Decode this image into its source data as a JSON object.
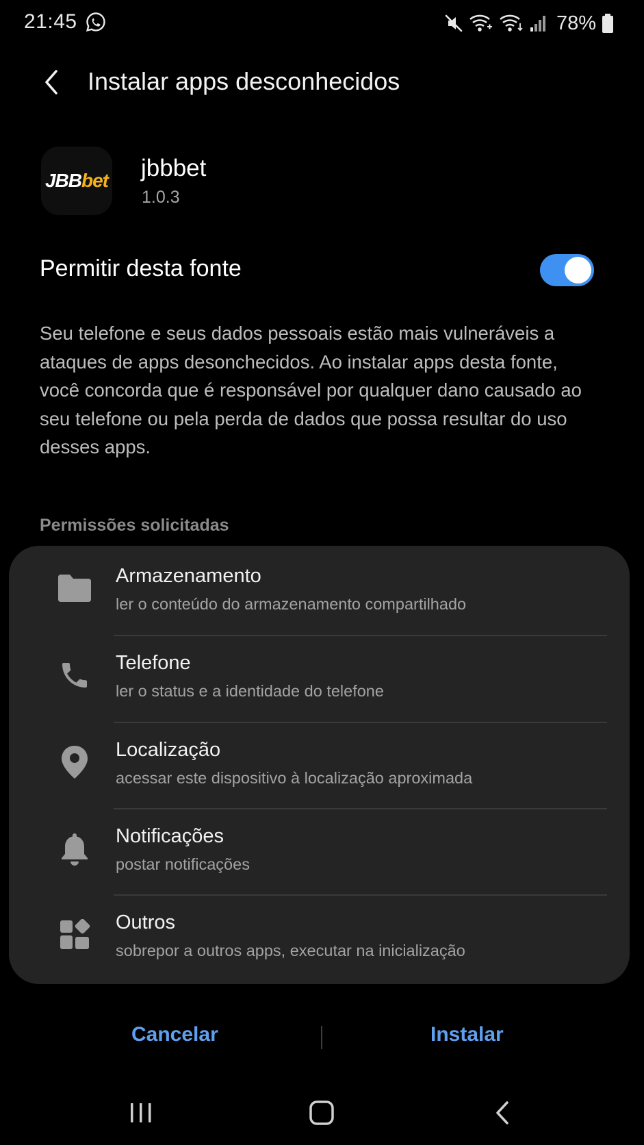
{
  "status_bar": {
    "time": "21:45",
    "battery": "78%",
    "icons": [
      "whatsapp-icon",
      "mute-icon",
      "wifi-call-icon",
      "wifi-icon",
      "signal-icon",
      "battery-icon"
    ]
  },
  "header": {
    "title": "Instalar apps desconhecidos",
    "back_icon": "back-chevron-icon"
  },
  "app": {
    "logo_text_a": "JBB",
    "logo_text_b": "bet",
    "name": "jbbbet",
    "version": "1.0.3"
  },
  "allow_setting": {
    "label": "Permitir desta fonte",
    "enabled": true
  },
  "warning_text": "Seu telefone e seus dados pessoais estão mais vulneráveis a ataques de apps desonchecidos. Ao instalar apps desta fonte, você concorda que é responsável por qualquer dano causado ao seu telefone ou pela perda de dados que possa resultar do uso desses apps.",
  "permissions": {
    "header": "Permissões solicitadas",
    "items": [
      {
        "icon": "folder-icon",
        "title": "Armazenamento",
        "description": "ler o conteúdo do armazenamento compartilhado"
      },
      {
        "icon": "phone-icon",
        "title": "Telefone",
        "description": "ler o status e a identidade do telefone"
      },
      {
        "icon": "location-pin-icon",
        "title": "Localização",
        "description": "acessar este dispositivo à localização aproximada"
      },
      {
        "icon": "bell-icon",
        "title": "Notificações",
        "description": "postar notificações"
      },
      {
        "icon": "widgets-icon",
        "title": "Outros",
        "description": "sobrepor a outros apps, executar na inicialização"
      }
    ]
  },
  "actions": {
    "cancel_label": "Cancelar",
    "install_label": "Instalar"
  },
  "colors": {
    "accent": "#3e91f0",
    "button_text": "#5fa0ee",
    "background": "#000000",
    "card": "#242424",
    "logo_yellow": "#f6b21b"
  },
  "nav": {
    "icons": [
      "recent-apps-icon",
      "home-icon",
      "back-icon"
    ]
  }
}
